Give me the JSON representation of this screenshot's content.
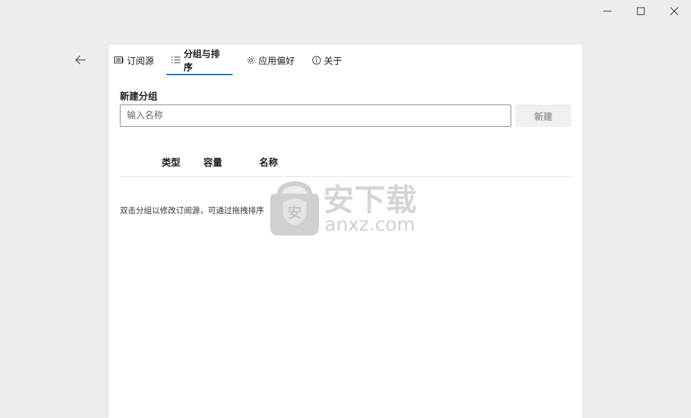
{
  "caption": {
    "minimize_icon": "minimize-icon",
    "maximize_icon": "maximize-icon",
    "close_icon": "close-icon"
  },
  "nav": {
    "back_icon": "arrow-left-icon"
  },
  "tabs": [
    {
      "label": "订阅源",
      "icon": "news-icon"
    },
    {
      "label": "分组与排序",
      "icon": "list-icon",
      "active": true
    },
    {
      "label": "应用偏好",
      "icon": "gear-icon"
    },
    {
      "label": "关于",
      "icon": "info-icon"
    }
  ],
  "new_group": {
    "title": "新建分组",
    "placeholder": "输入名称",
    "value": "",
    "create_label": "新建"
  },
  "table": {
    "columns": [
      "类型",
      "容量",
      "名称"
    ]
  },
  "hint": "双击分组以修改订阅源，可通过拖拽排序",
  "watermark": {
    "text_cn": "安下载",
    "text_en": "anxz.com",
    "badge_char": "安"
  },
  "colors": {
    "accent": "#1a73c9",
    "background": "#eeedeb",
    "card": "#ffffff"
  }
}
